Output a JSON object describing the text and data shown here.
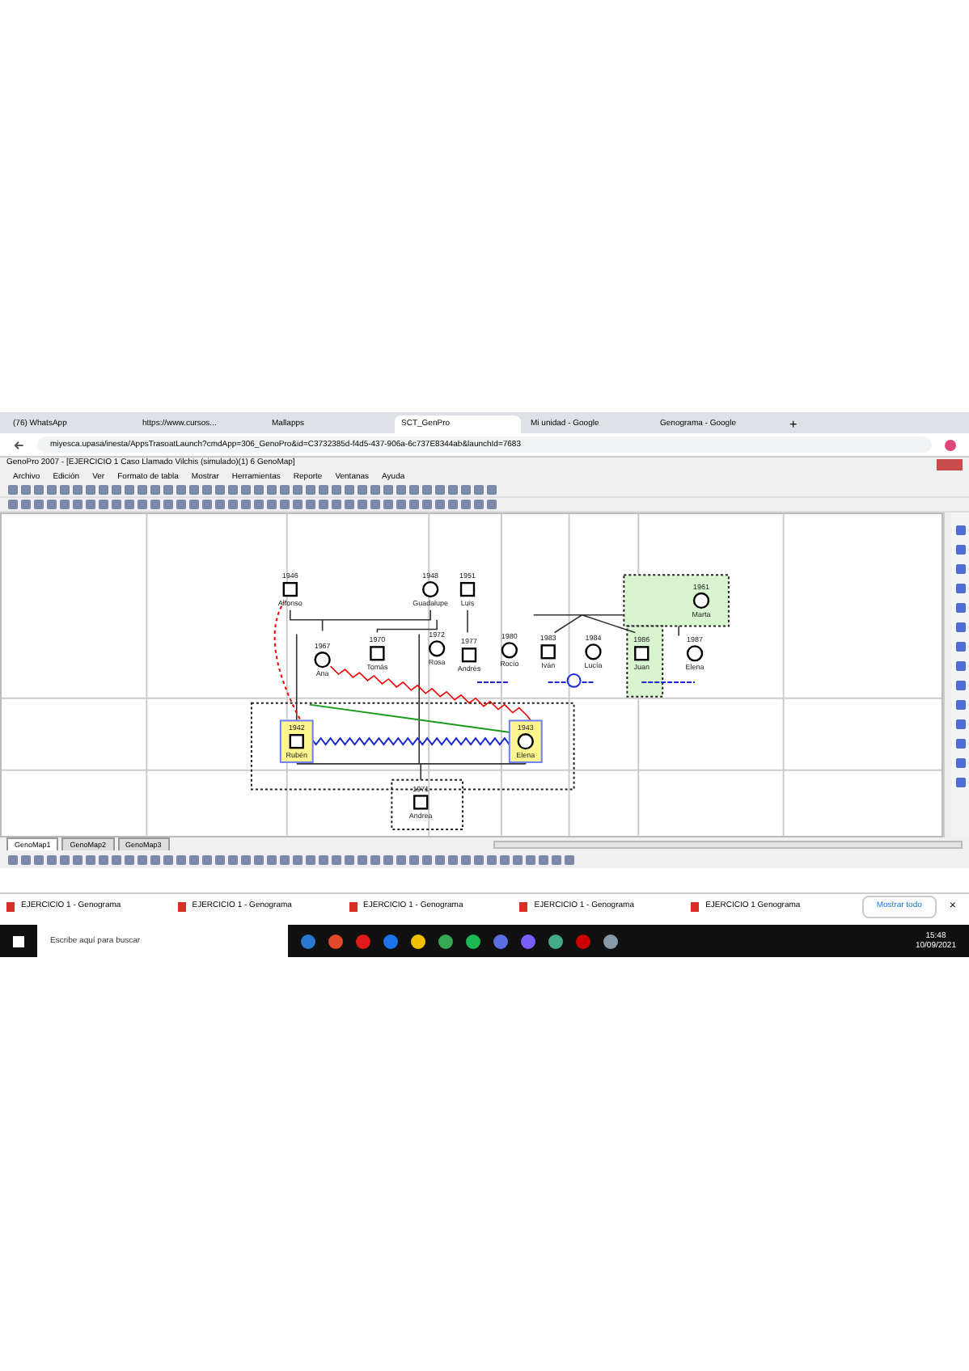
{
  "browser": {
    "tabs": [
      {
        "label": "(76) WhatsApp",
        "selected": false
      },
      {
        "label": "https://www.cursos...",
        "selected": false
      },
      {
        "label": "Mallapps",
        "selected": false
      },
      {
        "label": "SCT_GenPro",
        "selected": true
      },
      {
        "label": "Mi unidad - Google",
        "selected": false
      },
      {
        "label": "Genograma - Google",
        "selected": false
      }
    ],
    "new_tab": "+",
    "address": "miyesca.upasa/inesta/AppsTrasoatLaunch?cmdApp=306_GenoPro&id=C3732385d-f4d5-437-906a-6c737E8344ab&launchId=7683"
  },
  "app": {
    "title": "GenoPro 2007 - [EJERCICIO 1 Caso Llamado Vilchis (simulado)(1) 6 GenoMap]",
    "menu": [
      "Archivo",
      "Edición",
      "Ver",
      "Formato de tabla",
      "Mostrar",
      "Herramientas",
      "Reporte",
      "Ventanas",
      "Ayuda"
    ],
    "nodes": [
      {
        "kind": "male",
        "year": "1946",
        "name": "Alfonso",
        "selected": false
      },
      {
        "kind": "female",
        "year": "1948",
        "name": "Guadalupe",
        "selected": false
      },
      {
        "kind": "male",
        "year": "1951",
        "name": "Luis",
        "selected": false
      },
      {
        "kind": "female",
        "year": "1967",
        "name": "Ana",
        "selected": false
      },
      {
        "kind": "male",
        "year": "1970",
        "name": "Tomás",
        "selected": false
      },
      {
        "kind": "female",
        "year": "1972",
        "name": "Rosa",
        "selected": false
      },
      {
        "kind": "male",
        "year": "1977",
        "name": "Andrés",
        "selected": false
      },
      {
        "kind": "female",
        "year": "1980",
        "name": "Rocío",
        "selected": false
      },
      {
        "kind": "male",
        "year": "1983",
        "name": "Iván",
        "selected": false
      },
      {
        "kind": "female",
        "year": "1984",
        "name": "Lucía",
        "selected": false
      },
      {
        "kind": "male",
        "year": "1986",
        "name": "Juan",
        "selected": false
      },
      {
        "kind": "female",
        "year": "1987",
        "name": "Elena",
        "selected": false
      },
      {
        "kind": "female",
        "year": "1961",
        "name": "Marta",
        "selected": false
      },
      {
        "kind": "male",
        "year": "1942",
        "name": "Rubén",
        "selected": true
      },
      {
        "kind": "female",
        "year": "1943",
        "name": "Elena",
        "selected": true
      },
      {
        "kind": "male",
        "year": "1971",
        "name": "Andrea",
        "selected": false
      }
    ],
    "sheets": [
      {
        "label": "GenoMap1",
        "selected": true
      },
      {
        "label": "GenoMap2",
        "selected": false
      },
      {
        "label": "GenoMap3",
        "selected": false
      }
    ]
  },
  "downloads": {
    "items": [
      "EJERCICIO 1 - Genograma",
      "EJERCICIO 1 - Genograma",
      "EJERCICIO 1 - Genograma",
      "EJERCICIO 1 - Genograma",
      "EJERCICIO 1 Genograma"
    ],
    "show_all": "Mostrar todo",
    "close": "×"
  },
  "taskbar": {
    "search_placeholder": "Escribe aquí para buscar",
    "time": "15:48",
    "date": "10/09/2021"
  }
}
